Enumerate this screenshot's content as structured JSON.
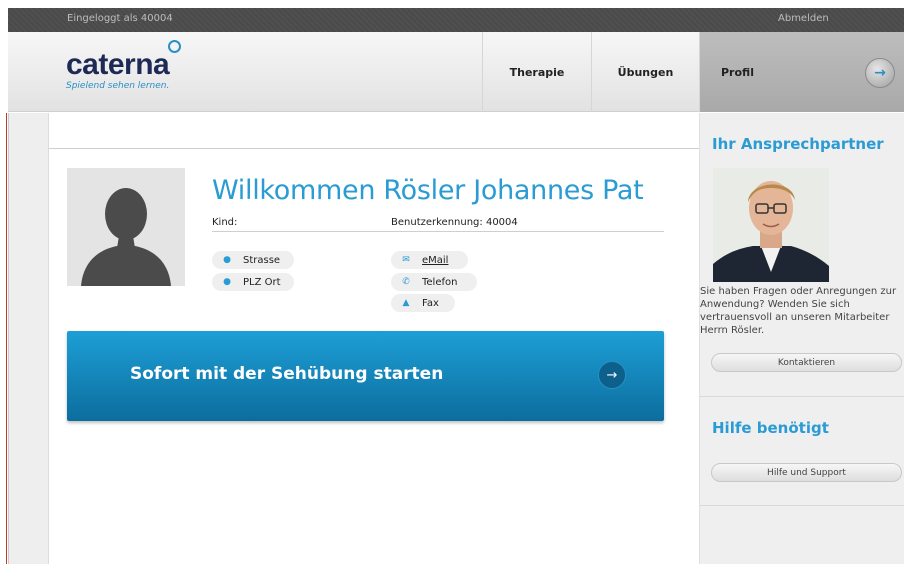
{
  "topbar": {
    "logged_in": "Eingeloggt als 40004",
    "logout": "Abmelden"
  },
  "logo": {
    "word": "caterna",
    "tagline": "Spielend sehen lernen."
  },
  "nav": {
    "therapie": "Therapie",
    "uebungen": "Übungen",
    "profil": "Profil",
    "profil_arrow": "→"
  },
  "profile": {
    "welcome": "Willkommen Rösler Johannes Pat",
    "kind": "Kind:",
    "user_id": "Benutzerkennung: 40004",
    "strasse": "Strasse",
    "plz_ort": "PLZ Ort",
    "email": "eMail",
    "telefon": "Telefon",
    "fax": "Fax"
  },
  "cta": {
    "label": "Sofort mit der Sehübung starten",
    "arrow": "→"
  },
  "sidebar": {
    "contact_title": "Ihr Ansprechpartner",
    "contact_text": "Sie haben Fragen oder Anregungen zur Anwendung? Wenden Sie sich vertrauensvoll an unseren Mitarbeiter Herrn Rösler.",
    "contact_button": "Kontaktieren",
    "help_title": "Hilfe benötigt",
    "help_button": "Hilfe und Support"
  },
  "colors": {
    "accent": "#2a9bd3",
    "cta_top": "#1d9fd6",
    "cta_bottom": "#0c6d9e",
    "brand_dark": "#1d2a55"
  },
  "icons": [
    "location-pin-icon",
    "email-icon",
    "phone-icon",
    "fax-icon",
    "arrow-right-icon"
  ]
}
